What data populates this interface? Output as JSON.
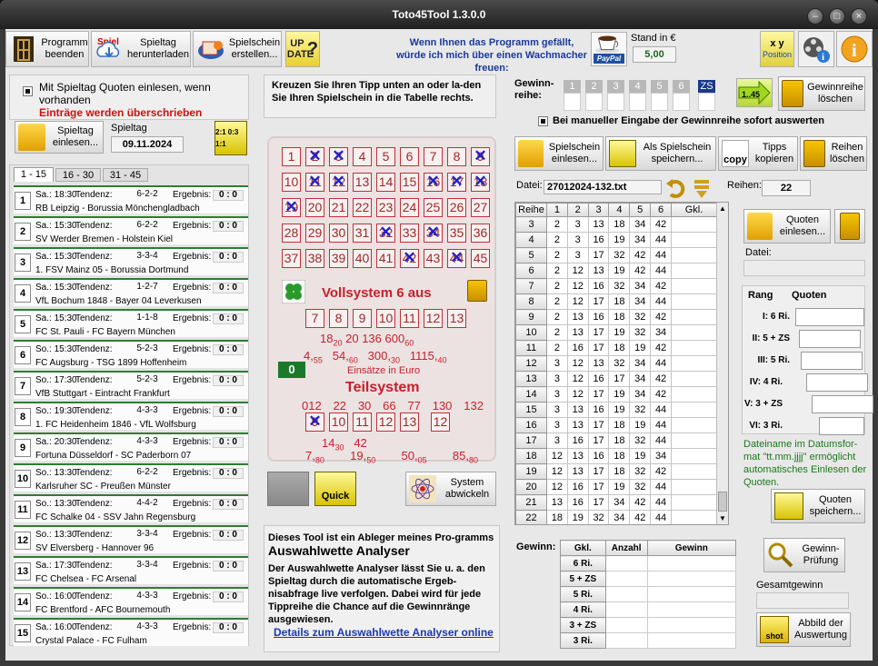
{
  "window": {
    "title": "Toto45Tool 1.3.0.0"
  },
  "toolbar": {
    "exit_label": "Programm beenden",
    "download_label": "Spieltag herunterladen",
    "create_label": "Spielschein erstellen...",
    "update_label": "UP DATE",
    "coffee_text": "Wenn Ihnen das Programm gefällt, würde ich mich über einen Wachmacher freuen:",
    "paypal_label": "PayPal",
    "stand_label": "Stand in €",
    "stand_value": "5,00",
    "position_label": "Position"
  },
  "left": {
    "quoten_checkbox": "Mit Spieltag Quoten einlesen, wenn vorhanden",
    "warning": "Einträge werden überschrieben",
    "load_button": "Spieltag einlesen...",
    "spieltag_label": "Spieltag",
    "spieltag_date": "09.11.2024",
    "tabs": [
      "1 - 15",
      "16 - 30",
      "31 - 45"
    ],
    "matches": [
      {
        "n": "1",
        "time": "Sa.: 18:30",
        "tend": "6-2-2",
        "erg": "0 : 0",
        "teams": "RB Leipzig - Borussia Mönchengladbach"
      },
      {
        "n": "2",
        "time": "Sa.: 15:30",
        "tend": "6-2-2",
        "erg": "0 : 0",
        "teams": "SV Werder Bremen - Holstein Kiel"
      },
      {
        "n": "3",
        "time": "Sa.: 15:30",
        "tend": "3-3-4",
        "erg": "0 : 0",
        "teams": "1. FSV Mainz 05 - Borussia Dortmund"
      },
      {
        "n": "4",
        "time": "Sa.: 15:30",
        "tend": "1-2-7",
        "erg": "0 : 0",
        "teams": "VfL Bochum 1848 - Bayer 04 Leverkusen"
      },
      {
        "n": "5",
        "time": "Sa.: 15:30",
        "tend": "1-1-8",
        "erg": "0 : 0",
        "teams": "FC St. Pauli - FC Bayern München"
      },
      {
        "n": "6",
        "time": "So.: 15:30",
        "tend": "5-2-3",
        "erg": "0 : 0",
        "teams": "FC Augsburg - TSG 1899 Hoffenheim"
      },
      {
        "n": "7",
        "time": "So.: 17:30",
        "tend": "5-2-3",
        "erg": "0 : 0",
        "teams": "VfB Stuttgart - Eintracht Frankfurt"
      },
      {
        "n": "8",
        "time": "So.: 19:30",
        "tend": "4-3-3",
        "erg": "0 : 0",
        "teams": "1. FC Heidenheim 1846 - VfL Wolfsburg"
      },
      {
        "n": "9",
        "time": "Sa.: 20:30",
        "tend": "4-3-3",
        "erg": "0 : 0",
        "teams": "Fortuna Düsseldorf - SC Paderborn 07"
      },
      {
        "n": "10",
        "time": "So.: 13:30",
        "tend": "6-2-2",
        "erg": "0 : 0",
        "teams": "Karlsruher SC - Preußen Münster"
      },
      {
        "n": "11",
        "time": "So.: 13:30",
        "tend": "4-4-2",
        "erg": "0 : 0",
        "teams": "FC Schalke 04 - SSV Jahn Regensburg"
      },
      {
        "n": "12",
        "time": "So.: 13:30",
        "tend": "3-3-4",
        "erg": "0 : 0",
        "teams": "SV Elversberg - Hannover 96"
      },
      {
        "n": "13",
        "time": "Sa.: 17:30",
        "tend": "3-3-4",
        "erg": "0 : 0",
        "teams": "FC Chelsea - FC Arsenal"
      },
      {
        "n": "14",
        "time": "So.: 16:00",
        "tend": "4-3-3",
        "erg": "0 : 0",
        "teams": "FC Brentford - AFC Bournemouth"
      },
      {
        "n": "15",
        "time": "Sa.: 16:00",
        "tend": "4-3-3",
        "erg": "0 : 0",
        "teams": "Crystal Palace - FC Fulham"
      }
    ],
    "tendenz_label": "Tendenz:",
    "ergebnis_label": "Ergebnis:"
  },
  "center": {
    "hint": "Kreuzen Sie Ihren Tipp unten an oder la-den Sie Ihren Spielschein in die Tabelle rechts.",
    "ticket_numbers": [
      "1",
      "2",
      "3",
      "4",
      "5",
      "6",
      "7",
      "8",
      "9",
      "10",
      "11",
      "12",
      "13",
      "14",
      "15",
      "16",
      "17",
      "18",
      "19",
      "20",
      "21",
      "22",
      "23",
      "24",
      "25",
      "26",
      "27",
      "28",
      "29",
      "30",
      "31",
      "32",
      "33",
      "34",
      "35",
      "36",
      "37",
      "38",
      "39",
      "40",
      "41",
      "42",
      "43",
      "44",
      "45"
    ],
    "vollsystem_title": "Vollsystem 6 aus",
    "vollsystem_numbers": [
      "7",
      "8",
      "9",
      "10",
      "11",
      "12",
      "13"
    ],
    "voll_counts": [
      "18",
      "20",
      "136",
      "600"
    ],
    "voll_counts_sub": [
      "20",
      "60"
    ],
    "voll_prices": [
      "4",
      "54",
      "300",
      "1115"
    ],
    "voll_prices_sub": [
      "55",
      "60",
      "30",
      "40"
    ],
    "counter": "0",
    "einsaetze": "Einsätze in Euro",
    "teilsystem_title": "Teilsystem",
    "teil_top": [
      "012",
      "22",
      "30",
      "66",
      "77",
      "130",
      "132"
    ],
    "teil_numbers": [
      "9",
      "10",
      "11",
      "12",
      "13",
      "12"
    ],
    "teil_counts": [
      "14",
      "42"
    ],
    "teil_counts_sub": [
      "30"
    ],
    "teil_prices": [
      "7",
      "19",
      "50",
      "85"
    ],
    "teil_prices_sub": [
      "80",
      "50",
      "05",
      "80"
    ],
    "quick_label": "Quick",
    "system_label": "System abwickeln",
    "info_p1": "Dieses Tool ist ein Ableger meines Pro-gramms",
    "info_bold": "Auswahlwette Analyser",
    "info_p2": "Der Auswahlwette Analyser lässt Sie u. a. den Spieltag durch die automatische Ergeb-nisabfrage live verfolgen. Dabei wird für jede Tippreihe die Chance auf die Gewinnränge ausgewiesen.",
    "info_link": "Details zum Auswahlwette Analyser online"
  },
  "right": {
    "gewinnreihe_label": "Gewinn-reihe:",
    "gewinn_heads": [
      "1",
      "2",
      "3",
      "4",
      "5",
      "6",
      "ZS"
    ],
    "range_label": "1..45",
    "clear_row_label": "Gewinnreihe löschen",
    "auto_check_label": "Bei manueller Eingabe der Gewinnreihe sofort auswerten",
    "load_ticket_label": "Spielschein einlesen...",
    "save_ticket_label": "Als Spielschein speichern...",
    "copy_label": "Tipps kopieren",
    "delete_rows_label": "Reihen löschen",
    "datei_label": "Datei:",
    "datei_value": "27012024-132.txt",
    "reihen_label": "Reihen:",
    "reihen_value": "22",
    "table_heads": [
      "Reihe",
      "1",
      "2",
      "3",
      "4",
      "5",
      "6",
      "Gkl."
    ],
    "rows": [
      {
        "r": "3",
        "v": [
          "2",
          "3",
          "13",
          "18",
          "34",
          "42"
        ]
      },
      {
        "r": "4",
        "v": [
          "2",
          "3",
          "16",
          "19",
          "34",
          "44"
        ]
      },
      {
        "r": "5",
        "v": [
          "2",
          "3",
          "17",
          "32",
          "42",
          "44"
        ]
      },
      {
        "r": "6",
        "v": [
          "2",
          "12",
          "13",
          "19",
          "42",
          "44"
        ]
      },
      {
        "r": "7",
        "v": [
          "2",
          "12",
          "16",
          "32",
          "34",
          "42"
        ]
      },
      {
        "r": "8",
        "v": [
          "2",
          "12",
          "17",
          "18",
          "34",
          "44"
        ]
      },
      {
        "r": "9",
        "v": [
          "2",
          "13",
          "16",
          "18",
          "32",
          "42"
        ]
      },
      {
        "r": "10",
        "v": [
          "2",
          "13",
          "17",
          "19",
          "32",
          "34"
        ]
      },
      {
        "r": "11",
        "v": [
          "2",
          "16",
          "17",
          "18",
          "19",
          "42"
        ]
      },
      {
        "r": "12",
        "v": [
          "3",
          "12",
          "13",
          "32",
          "34",
          "44"
        ]
      },
      {
        "r": "13",
        "v": [
          "3",
          "12",
          "16",
          "17",
          "34",
          "42"
        ]
      },
      {
        "r": "14",
        "v": [
          "3",
          "12",
          "17",
          "19",
          "34",
          "42"
        ]
      },
      {
        "r": "15",
        "v": [
          "3",
          "13",
          "16",
          "19",
          "32",
          "44"
        ]
      },
      {
        "r": "16",
        "v": [
          "3",
          "13",
          "17",
          "18",
          "19",
          "44"
        ]
      },
      {
        "r": "17",
        "v": [
          "3",
          "16",
          "17",
          "18",
          "32",
          "44"
        ]
      },
      {
        "r": "18",
        "v": [
          "12",
          "13",
          "16",
          "18",
          "19",
          "34"
        ]
      },
      {
        "r": "19",
        "v": [
          "12",
          "13",
          "17",
          "18",
          "32",
          "42"
        ]
      },
      {
        "r": "20",
        "v": [
          "12",
          "16",
          "17",
          "19",
          "32",
          "44"
        ]
      },
      {
        "r": "21",
        "v": [
          "13",
          "16",
          "17",
          "34",
          "42",
          "44"
        ]
      },
      {
        "r": "22",
        "v": [
          "18",
          "19",
          "32",
          "34",
          "42",
          "44"
        ]
      }
    ],
    "quoten_load_label": "Quoten einlesen...",
    "quoten_datei": "Datei:",
    "rang_label": "Rang",
    "quoten_label": "Quoten",
    "raenge": [
      "I: 6 Ri.",
      "II: 5 + ZS",
      "III: 5 Ri.",
      "IV: 4 Ri.",
      "V: 3 + ZS",
      "VI: 3 Ri."
    ],
    "quoten_note": "Dateiname im Datumsfor-mat \"tt.mm.jjjj\" ermöglicht automatisches Einlesen der Quoten.",
    "quoten_save_label": "Quoten speichern...",
    "gewinn_label": "Gewinn:",
    "gewinn_heads2": [
      "Gkl.",
      "Anzahl",
      "Gewinn"
    ],
    "gewinn_klassen": [
      "6 Ri.",
      "5 + ZS",
      "5 Ri.",
      "4 Ri.",
      "3 + ZS",
      "3 Ri."
    ],
    "pruefung_label": "Gewinn-Prüfung",
    "gesamt_label": "Gesamtgewinn",
    "shot_label": "Abbild der Auswertung"
  }
}
